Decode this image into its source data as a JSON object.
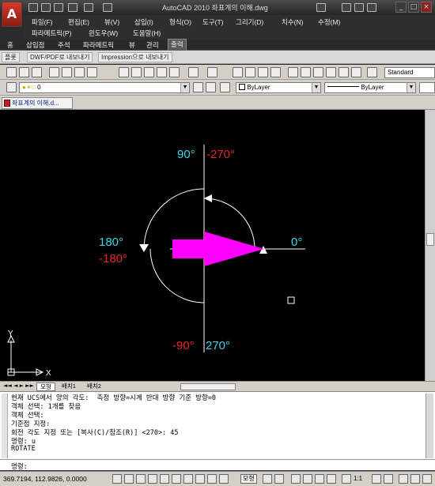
{
  "window": {
    "title": "AutoCAD 2010   좌표계의 이해.dwg",
    "app_letter": "A"
  },
  "menu": {
    "row1": [
      "파일(F)",
      "편집(E)",
      "뷰(V)",
      "삽입(I)",
      "형식(O)",
      "도구(T)",
      "그리기(D)",
      "치수(N)",
      "수정(M)"
    ],
    "row2": [
      "파라메트릭(P)",
      "윈도우(W)",
      "도움말(H)"
    ]
  },
  "ribbon": {
    "tabs": [
      "홈",
      "삽입점",
      "주석",
      "파라메트릭",
      "뷰",
      "관리",
      "출력"
    ],
    "active_tab": "출력",
    "panels": [
      "플롯",
      "DWF/PDF로 내보내기",
      "Impression으로 내보내기"
    ]
  },
  "toolbar": {
    "workspace": "Standard",
    "layer": "0",
    "color": "ByLayer",
    "linetype": "ByLayer"
  },
  "document": {
    "tab_title": "좌표계의 이해.d..."
  },
  "drawing": {
    "labels_cyan": {
      "top": "90°",
      "left": "180°",
      "right": "0°",
      "bottom": "270°"
    },
    "labels_red": {
      "top": "-270°",
      "left": "-180°",
      "bottom": "-90°"
    },
    "ucs": {
      "x": "X",
      "y": "Y"
    },
    "colors": {
      "cyan": "#3fd4e8",
      "red": "#e8262a",
      "magenta": "#ff00ff",
      "white": "#ffffff"
    }
  },
  "layouts": {
    "tabs": [
      "모형",
      "배치1",
      "배치2"
    ],
    "active": "모형"
  },
  "command": {
    "history": [
      "현재 UCS에서 양의 각도:  측정 방향=시계 반대 방향 기준 방향=0",
      "객체 선택: 1개를 찾음",
      "객체 선택:",
      "기준점 지정:",
      "회전 각도 지정 또는 [복사(C)/참조(R)] <270>: 45",
      "명령: u",
      "ROTATE"
    ],
    "prompt": "명령:"
  },
  "status": {
    "coordinates": "369.7194, 112.9826, 0.0000",
    "model_label": "모형",
    "scale": "1:1"
  }
}
